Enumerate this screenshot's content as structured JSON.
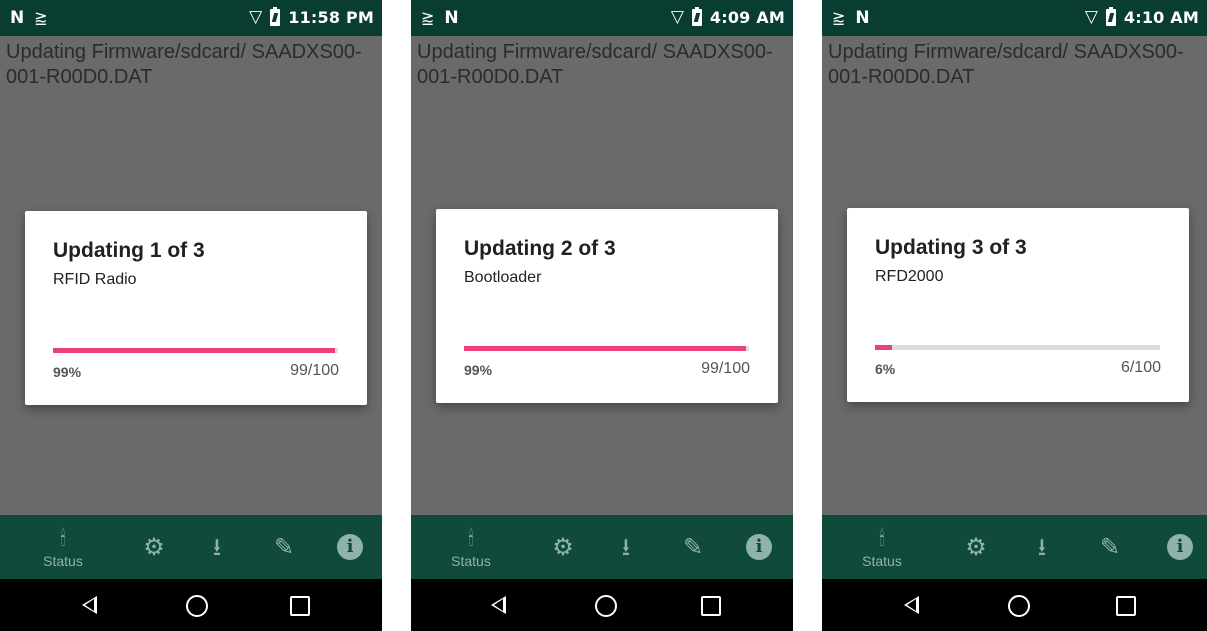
{
  "screens": [
    {
      "status_bar": {
        "left_icons": [
          "nfc-icon",
          "cast-icon"
        ],
        "time": "11:58 PM"
      },
      "update_text": "Updating Firmware/sdcard/ SAADXS00-001-R00D0.DAT",
      "dialog": {
        "title": "Updating 1 of 3",
        "subtitle": "RFID Radio",
        "progress_fraction": 0.99,
        "percent_label": "99%",
        "count_label": "99/100"
      },
      "bottom_nav": {
        "status_label": "Status"
      }
    },
    {
      "status_bar": {
        "left_icons": [
          "cast-icon",
          "nfc-icon"
        ],
        "time": "4:09 AM"
      },
      "update_text": "Updating Firmware/sdcard/ SAADXS00-001-R00D0.DAT",
      "dialog": {
        "title": "Updating 2 of 3",
        "subtitle": "Bootloader",
        "progress_fraction": 0.99,
        "percent_label": "99%",
        "count_label": "99/100"
      },
      "bottom_nav": {
        "status_label": "Status"
      }
    },
    {
      "status_bar": {
        "left_icons": [
          "cast-icon",
          "nfc-icon"
        ],
        "time": "4:10 AM"
      },
      "update_text": "Updating Firmware/sdcard/ SAADXS00-001-R00D0.DAT",
      "dialog": {
        "title": "Updating 3 of 3",
        "subtitle": "RFD2000",
        "progress_fraction": 0.06,
        "percent_label": "6%",
        "count_label": "6/100"
      },
      "bottom_nav": {
        "status_label": "Status"
      }
    }
  ],
  "colors": {
    "status_bar": "#0a3d31",
    "bottom_nav": "#0f4a3b",
    "progress_accent": "#ec407a",
    "scrim": "#6a6a6a"
  }
}
